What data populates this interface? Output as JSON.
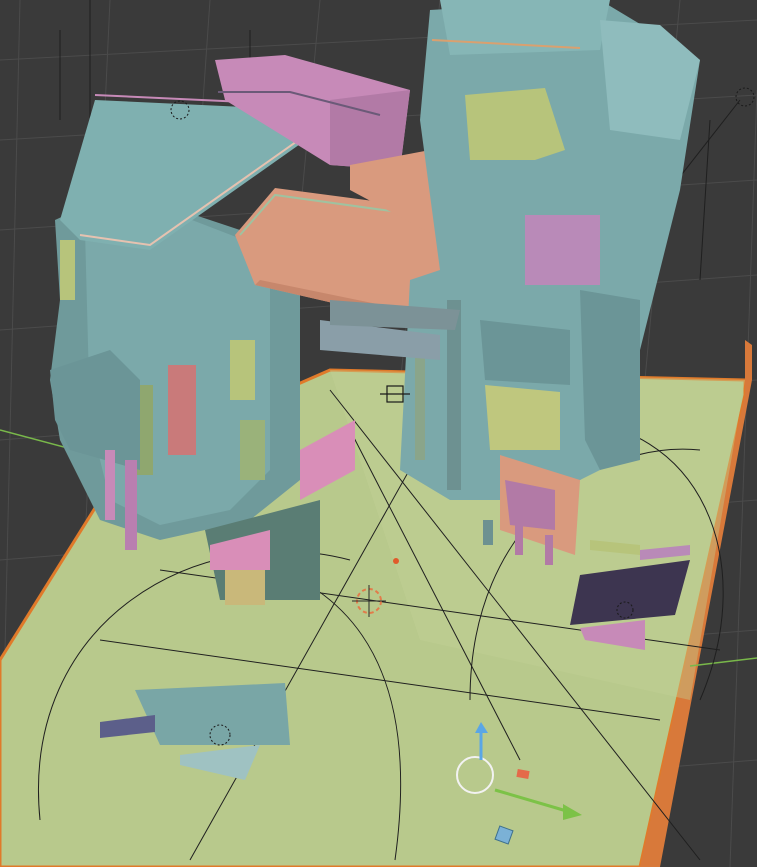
{
  "app": {
    "view": "3D Viewport",
    "shading": "solid"
  },
  "colors": {
    "background": "#3a3a3a",
    "grid_line": "#4a4a4a",
    "ground": "#b8c98c",
    "ground_edge": "#e07a2a",
    "selection_outline": "#ff8a2a",
    "building_teal": "#79a6a6",
    "building_teal_dark": "#5f8b8c",
    "building_pink": "#c78ab8",
    "building_salmon": "#d99a7e",
    "building_yellow_green": "#bfc77e",
    "building_dark_purple": "#3d3550",
    "axis_y_green": "#7cc247",
    "axis_z_blue": "#5aa6e6",
    "gizmo_white": "#f2f2f2"
  },
  "scene": {
    "objects": [
      "building-left-tower",
      "building-right-tower",
      "bridge-upper-pink",
      "bridge-lower-salmon",
      "storefront-left",
      "kiosk-right",
      "billboard-dark",
      "billboard-teal",
      "ground-plane"
    ],
    "gizmo_icons": [
      "light-empty-icon",
      "camera-empty-icon",
      "origin-3d-cursor-icon",
      "transform-gizmo-icon"
    ]
  }
}
